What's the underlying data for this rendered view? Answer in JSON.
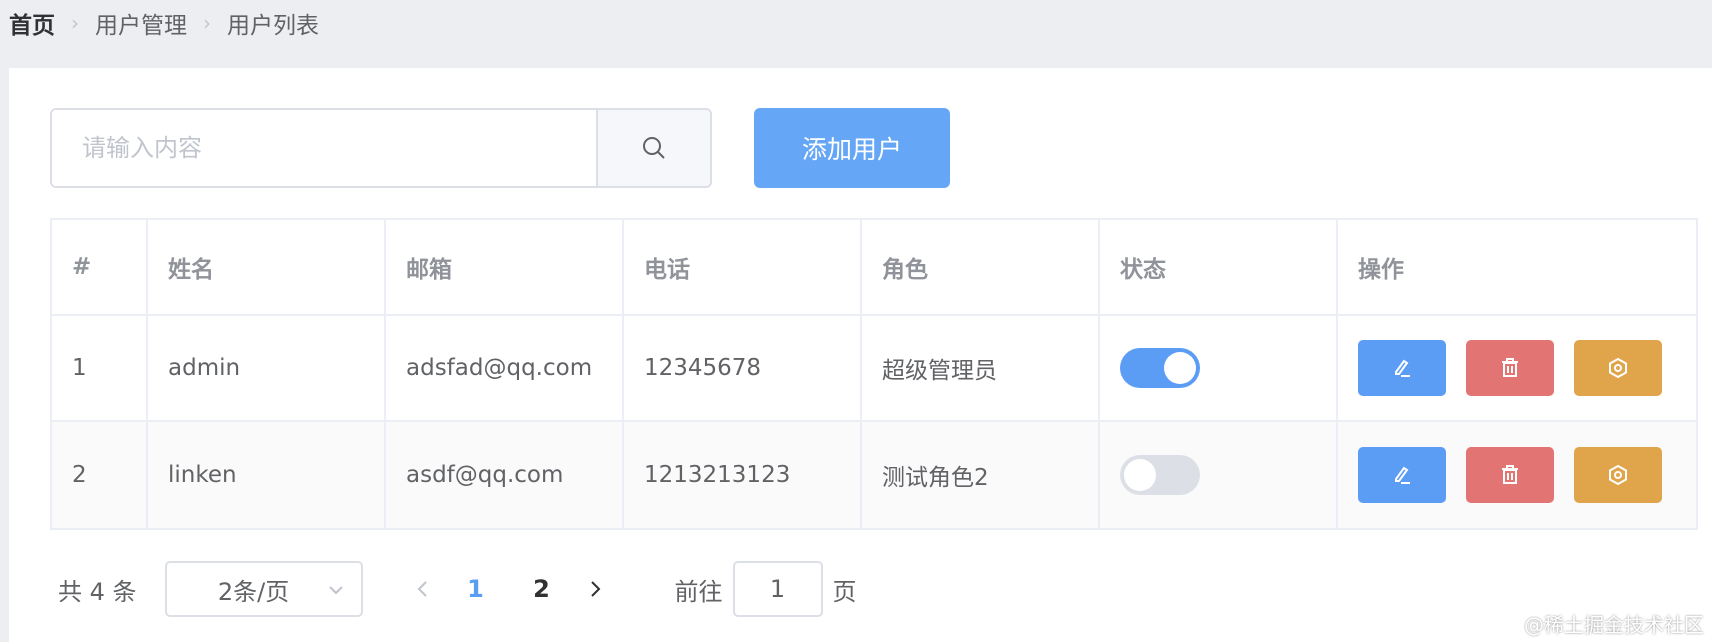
{
  "breadcrumb": {
    "items": [
      "首页",
      "用户管理",
      "用户列表"
    ]
  },
  "toolbar": {
    "search_placeholder": "请输入内容",
    "search_value": "",
    "add_label": "添加用户"
  },
  "table": {
    "headers": [
      "#",
      "姓名",
      "邮箱",
      "电话",
      "角色",
      "状态",
      "操作"
    ],
    "rows": [
      {
        "index": "1",
        "name": "admin",
        "email": "adsfad@qq.com",
        "phone": "12345678",
        "role": "超级管理员",
        "status": true
      },
      {
        "index": "2",
        "name": "linken",
        "email": "asdf@qq.com",
        "phone": "1213213123",
        "role": "测试角色2",
        "status": false
      }
    ]
  },
  "pagination": {
    "total_label": "共 4 条",
    "page_size_label": "2条/页",
    "pages": [
      "1",
      "2"
    ],
    "current_page": "1",
    "goto_prefix": "前往",
    "goto_value": "1",
    "goto_suffix": "页"
  },
  "watermark": "@稀土掘金技术社区",
  "colors": {
    "primary": "#5b9cf5",
    "danger": "#e37474",
    "warning": "#e0a54a"
  }
}
